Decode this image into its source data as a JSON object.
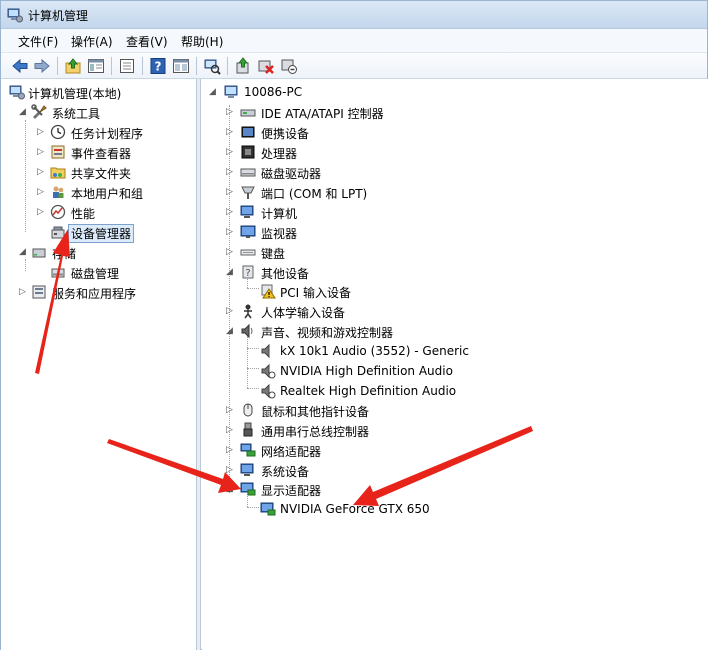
{
  "window": {
    "title": "计算机管理"
  },
  "menu": {
    "items": [
      "文件(F)",
      "操作(A)",
      "查看(V)",
      "帮助(H)"
    ]
  },
  "toolbar": {
    "buttons": [
      "back-icon",
      "forward-icon",
      "up-icon",
      "show-tree-icon",
      "export-icon",
      "help-icon",
      "properties-icon",
      "scan-hardware-icon",
      "update-driver-icon",
      "disable-device-icon",
      "uninstall-device-icon"
    ]
  },
  "left_tree": {
    "root": "计算机管理(本地)",
    "system_tools": "系统工具",
    "task_scheduler": "任务计划程序",
    "event_viewer": "事件查看器",
    "shared_folders": "共享文件夹",
    "local_users": "本地用户和组",
    "performance": "性能",
    "device_manager": "设备管理器",
    "storage": "存储",
    "disk_management": "磁盘管理",
    "services_apps": "服务和应用程序"
  },
  "right_tree": {
    "computer": "10086-PC",
    "ide": "IDE ATA/ATAPI 控制器",
    "portable": "便携设备",
    "processor": "处理器",
    "disk_drives": "磁盘驱动器",
    "ports": "端口 (COM 和 LPT)",
    "computer_cat": "计算机",
    "monitors": "监视器",
    "keyboards": "键盘",
    "other_devices": "其他设备",
    "pci_input": "PCI 输入设备",
    "hid": "人体学输入设备",
    "sound": "声音、视频和游戏控制器",
    "kx_audio": "kX 10k1 Audio (3552) - Generic",
    "nvidia_hd_audio": "NVIDIA High Definition Audio",
    "realtek_audio": "Realtek High Definition Audio",
    "mice": "鼠标和其他指针设备",
    "usb": "通用串行总线控制器",
    "network": "网络适配器",
    "system_devices": "系统设备",
    "display_adapters": "显示适配器",
    "gpu": "NVIDIA GeForce GTX 650"
  },
  "colors": {
    "annotation_arrow": "#e8231a",
    "selection_bg": "#dcebfc",
    "selection_border": "#7da2ce",
    "title_bar": "#c3d6ec"
  }
}
